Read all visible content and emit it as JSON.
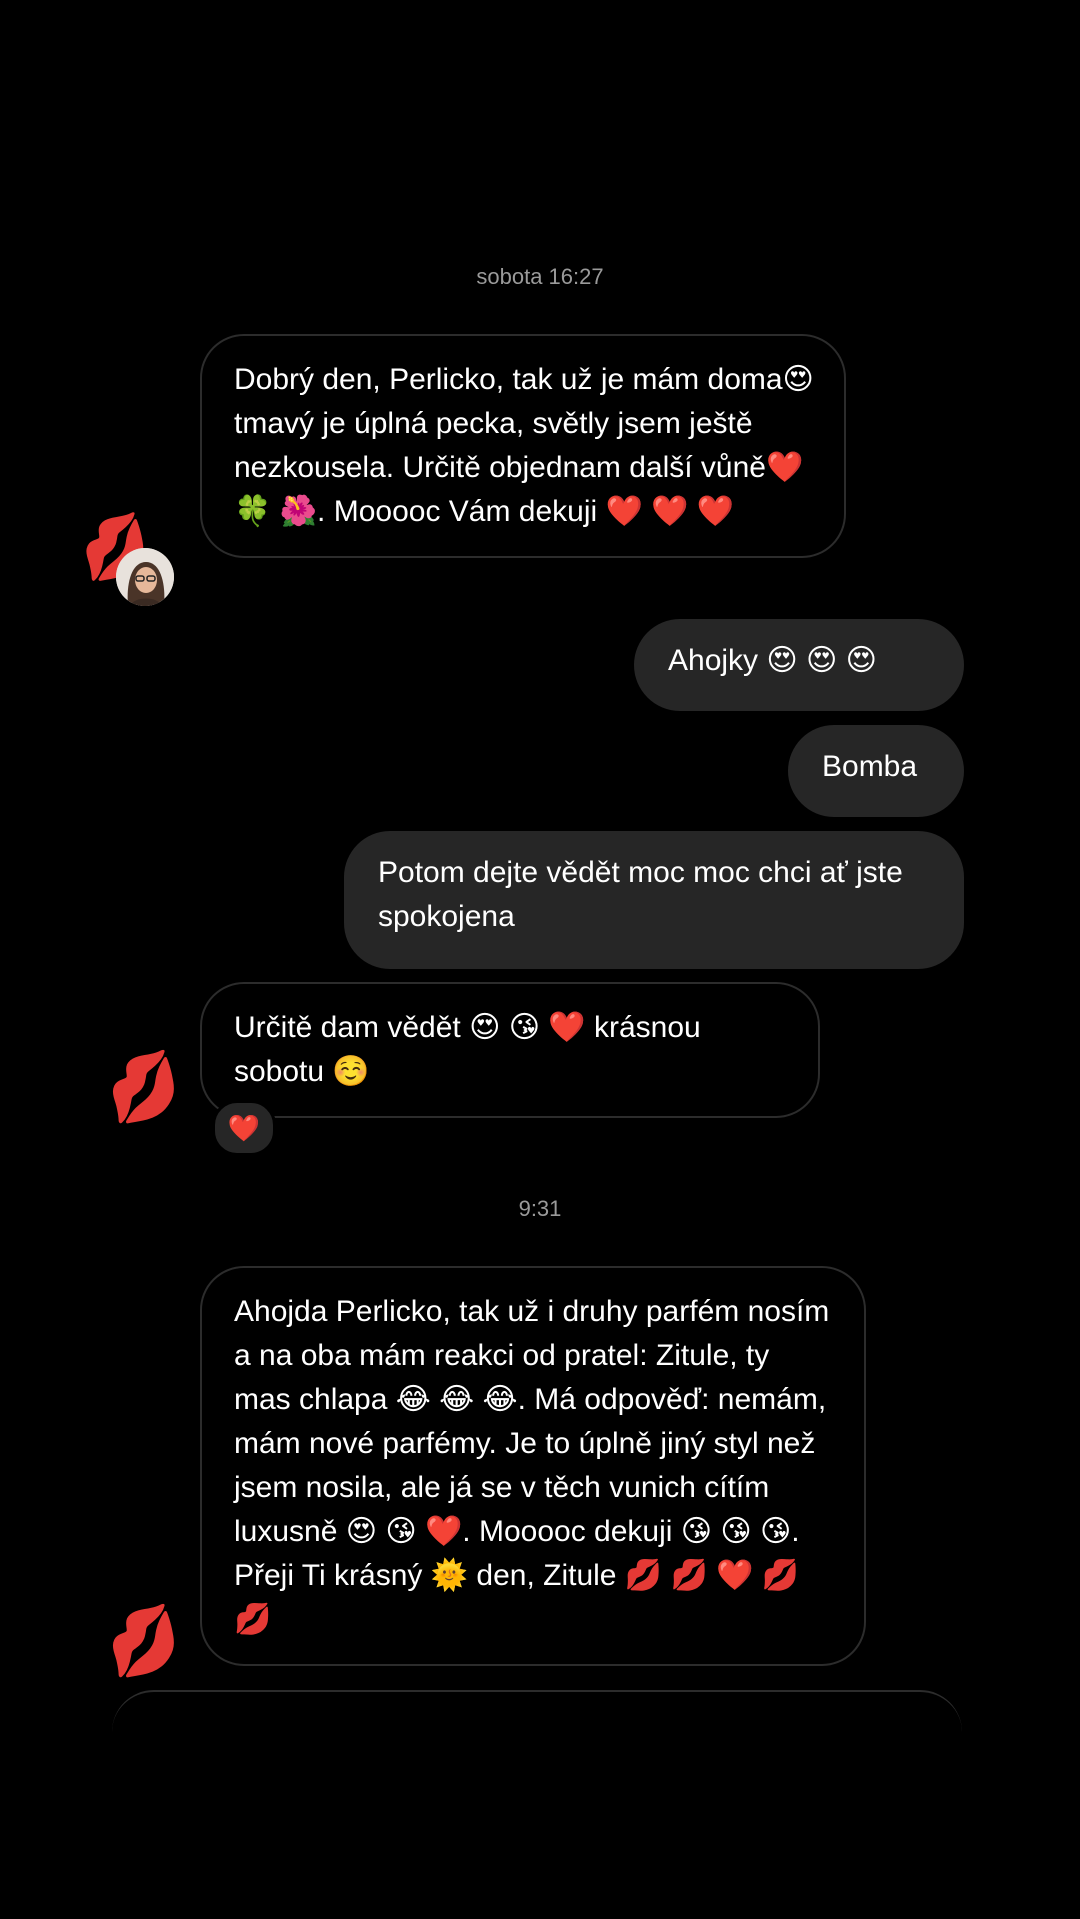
{
  "thread": {
    "timestamp_1": "sobota 16:27",
    "timestamp_2": "9:31",
    "messages": [
      {
        "direction": "incoming",
        "text": "Dobrý den, Perlicko, tak už je mám doma😍tmavý je úplná pecka, světly jsem ještě nezkousela. Určitě objednam další vůně❤️ 🍀 🌺. Mooooc Vám dekuji ❤️ ❤️ ❤️"
      },
      {
        "direction": "outgoing",
        "text": "Ahojky 😍 😍 😍"
      },
      {
        "direction": "outgoing",
        "text": "Bomba"
      },
      {
        "direction": "outgoing",
        "text": "Potom dejte vědět moc moc chci ať jste spokojena"
      },
      {
        "direction": "incoming",
        "text": "Určitě dam vědět 😍 😘 ❤️ krásnou sobotu ☺️",
        "reaction": "❤️"
      },
      {
        "direction": "incoming",
        "text": "Ahojda Perlicko, tak už i druhy parfém nosím a na oba mám reakci od pratel: Zitule, ty mas chlapa 😂 😂 😂. Má odpověď: nemám, mám nové parfémy. Je to úplně jiný styl než jsem nosila, ale já se v těch vunich cítím luxusně 😍 😘 ❤️. Mooooc dekuji 😘 😘 😘. Přeji Ti krásný 🌞 den, Zitule 💋 💋 ❤️ 💋 💋"
      }
    ],
    "stickers": {
      "kiss": "💋"
    }
  },
  "colors": {
    "background": "#000000",
    "incoming_border": "#2c2c2c",
    "outgoing_bubble": "#262626",
    "timestamp": "#9a9a9a"
  }
}
